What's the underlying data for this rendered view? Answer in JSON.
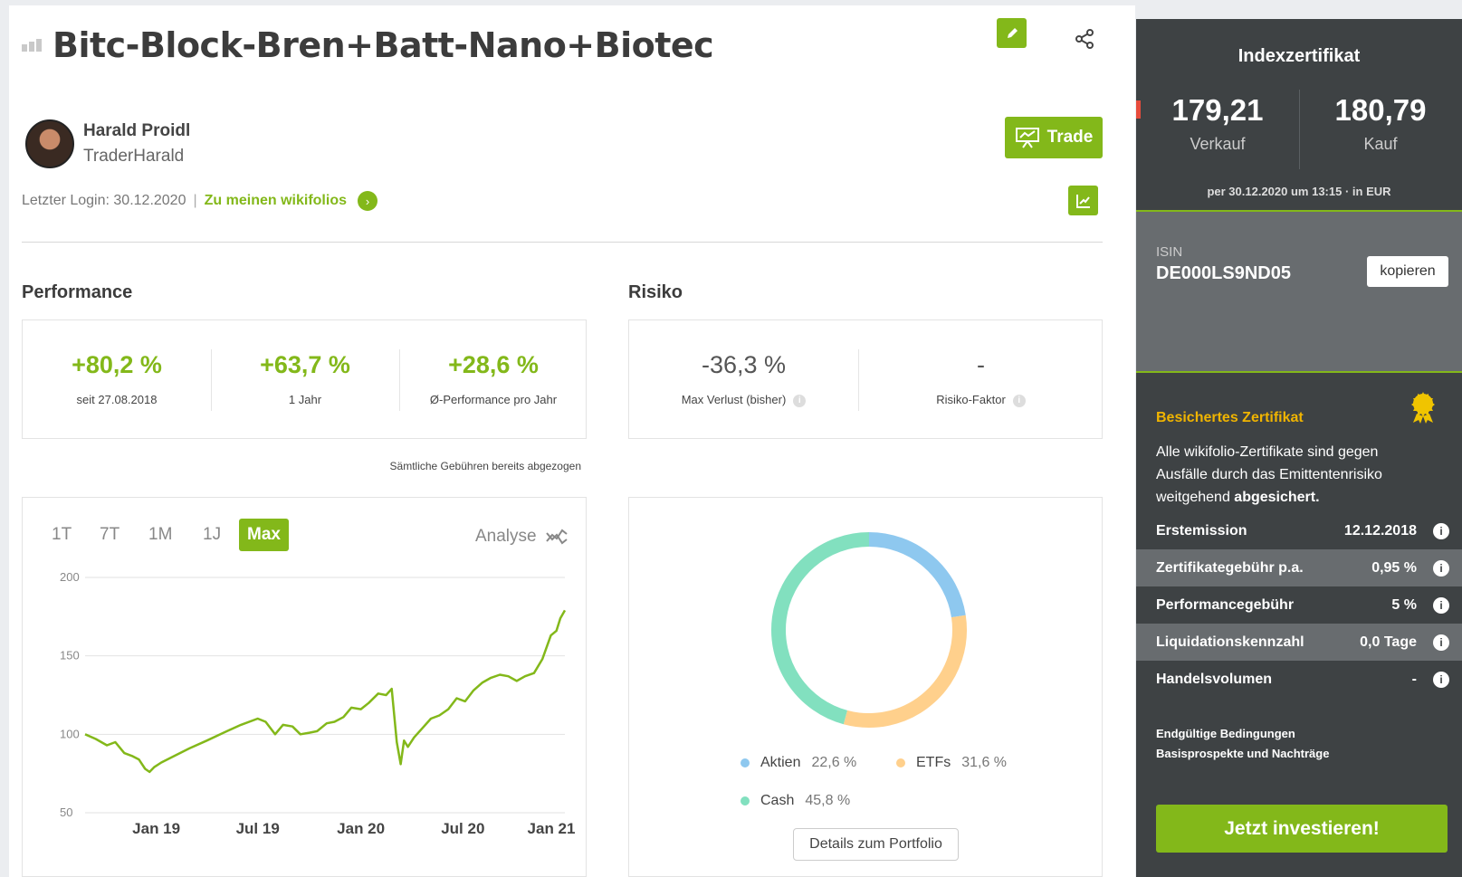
{
  "header": {
    "title": "Bitc-Block-Bren+Batt-Nano+Biotec"
  },
  "trader": {
    "name": "Harald Proidl",
    "username": "TraderHarald",
    "trade_label": "Trade"
  },
  "login": {
    "last_login": "Letzter Login: 30.12.2020",
    "separator": "|",
    "link": "Zu meinen wikifolios"
  },
  "performance": {
    "title": "Performance",
    "kpis": [
      {
        "value": "+80,2 %",
        "label": "seit 27.08.2018"
      },
      {
        "value": "+63,7 %",
        "label": "1 Jahr"
      },
      {
        "value": "+28,6 %",
        "label": "Ø-Performance pro Jahr"
      }
    ],
    "fees_note": "Sämtliche Gebühren bereits abgezogen"
  },
  "risk": {
    "title": "Risiko",
    "kpis": [
      {
        "value": "-36,3 %",
        "label": "Max Verlust (bisher)"
      },
      {
        "value": "-",
        "label": "Risiko-Faktor"
      }
    ]
  },
  "chart_controls": {
    "ranges": [
      "1T",
      "7T",
      "1M",
      "1J",
      "Max"
    ],
    "active": "Max",
    "analyse_label": "Analyse"
  },
  "chart_data": {
    "type": "line",
    "x_ticks": [
      "Jan 19",
      "Jul 19",
      "Jan 20",
      "Jul 20",
      "Jan 21"
    ],
    "y_ticks": [
      "200",
      "150",
      "100",
      "50"
    ],
    "ylim": [
      50,
      200
    ],
    "grid": true,
    "series": [
      {
        "color": "#83b81a",
        "x": [
          "2018-08-27",
          "2018-09-15",
          "2018-10-05",
          "2018-10-20",
          "2018-11-05",
          "2018-11-20",
          "2018-12-01",
          "2018-12-12",
          "2018-12-20",
          "2018-12-28",
          "2019-01-10",
          "2019-02-01",
          "2019-03-01",
          "2019-04-01",
          "2019-05-01",
          "2019-06-01",
          "2019-07-01",
          "2019-07-15",
          "2019-08-01",
          "2019-08-15",
          "2019-09-01",
          "2019-09-15",
          "2019-10-01",
          "2019-10-15",
          "2019-11-01",
          "2019-11-15",
          "2019-12-01",
          "2019-12-15",
          "2020-01-01",
          "2020-01-15",
          "2020-02-01",
          "2020-02-15",
          "2020-02-25",
          "2020-03-05",
          "2020-03-12",
          "2020-03-18",
          "2020-03-25",
          "2020-04-05",
          "2020-04-20",
          "2020-05-05",
          "2020-05-20",
          "2020-06-05",
          "2020-06-20",
          "2020-07-05",
          "2020-07-20",
          "2020-08-05",
          "2020-08-20",
          "2020-09-05",
          "2020-09-20",
          "2020-10-05",
          "2020-10-20",
          "2020-11-05",
          "2020-11-20",
          "2020-12-05",
          "2020-12-15",
          "2020-12-22",
          "2020-12-30"
        ],
        "y": [
          100,
          97,
          93,
          95,
          88,
          86,
          84,
          78,
          76,
          79,
          82,
          86,
          91,
          96,
          101,
          106,
          110,
          108,
          100,
          106,
          105,
          100,
          101,
          102,
          107,
          108,
          111,
          117,
          116,
          120,
          126,
          125,
          129,
          95,
          81,
          96,
          92,
          98,
          104,
          110,
          112,
          116,
          123,
          121,
          128,
          133,
          136,
          138,
          137,
          134,
          137,
          139,
          148,
          163,
          166,
          174,
          179
        ]
      }
    ]
  },
  "allocation": {
    "legend": [
      {
        "label": "Aktien",
        "pct": "22,6 %",
        "color": "#8ec8ef"
      },
      {
        "label": "ETFs",
        "pct": "31,6 %",
        "color": "#ffd08c"
      },
      {
        "label": "Cash",
        "pct": "45,8 %",
        "color": "#82e0bf"
      }
    ],
    "details_label": "Details zum Portfolio"
  },
  "sidebar": {
    "type": "Indexzertifikat",
    "sell_price": "179,21",
    "sell_label": "Verkauf",
    "buy_price": "180,79",
    "buy_label": "Kauf",
    "per_note": "per 30.12.2020 um 13:15 · in EUR",
    "isin_label": "ISIN",
    "isin": "DE000LS9ND05",
    "copy_label": "kopieren",
    "guarantee_title": "Besichertes Zertifikat",
    "guarantee_text_1": "Alle wikifolio-Zertifikate sind gegen Ausfälle durch das Emittentenrisiko weitgehend ",
    "guarantee_text_bold": "abgesichert.",
    "rows": [
      {
        "label": "Erstemission",
        "value": "12.12.2018"
      },
      {
        "label": "Zertifikategebühr p.a.",
        "value": "0,95 %"
      },
      {
        "label": "Performancegebühr",
        "value": "5 %"
      },
      {
        "label": "Liquidationskennzahl",
        "value": "0,0 Tage"
      },
      {
        "label": "Handelsvolumen",
        "value": "-"
      }
    ],
    "links": [
      "Endgültige Bedingungen",
      "Basisprospekte und Nachträge"
    ],
    "invest_label": "Jetzt investieren!"
  },
  "colors": {
    "accent": "#83b81a",
    "sidebar_bg": "#3e4244",
    "sidebar_alt": "#686c6f",
    "gold": "#f0b400"
  },
  "icons": {
    "edit": "pencil-icon",
    "share": "share-icon",
    "chart": "chart-icon",
    "trade": "presentation-icon",
    "arrow": "chevron-right-icon",
    "info": "info-icon",
    "award": "award-icon",
    "analyse": "analyse-icon"
  }
}
